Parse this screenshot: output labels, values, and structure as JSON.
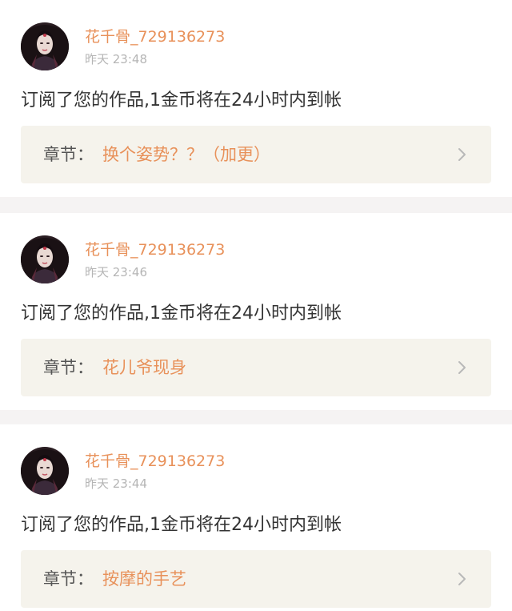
{
  "feed": {
    "items": [
      {
        "user_name": "花千骨_729136273",
        "time": "昨天 23:48",
        "message": "订阅了您的作品,1金币将在24小时内到帐",
        "chapter_prefix": "章节：",
        "chapter_title": "换个姿势？？（加更）",
        "avatar_icon": "avatar-portrait-icon",
        "chevron_icon": "chevron-right-icon"
      },
      {
        "user_name": "花千骨_729136273",
        "time": "昨天 23:46",
        "message": "订阅了您的作品,1金币将在24小时内到帐",
        "chapter_prefix": "章节：",
        "chapter_title": "花儿爷现身",
        "avatar_icon": "avatar-portrait-icon",
        "chevron_icon": "chevron-right-icon"
      },
      {
        "user_name": "花千骨_729136273",
        "time": "昨天 23:44",
        "message": "订阅了您的作品,1金币将在24小时内到帐",
        "chapter_prefix": "章节：",
        "chapter_title": "按摩的手艺",
        "avatar_icon": "avatar-portrait-icon",
        "chevron_icon": "chevron-right-icon"
      }
    ]
  },
  "colors": {
    "accent": "#e8915a",
    "text": "#333333",
    "muted": "#b5b5b5",
    "chapter_bg": "#f5f3ec",
    "separator": "#f5f3f3"
  }
}
